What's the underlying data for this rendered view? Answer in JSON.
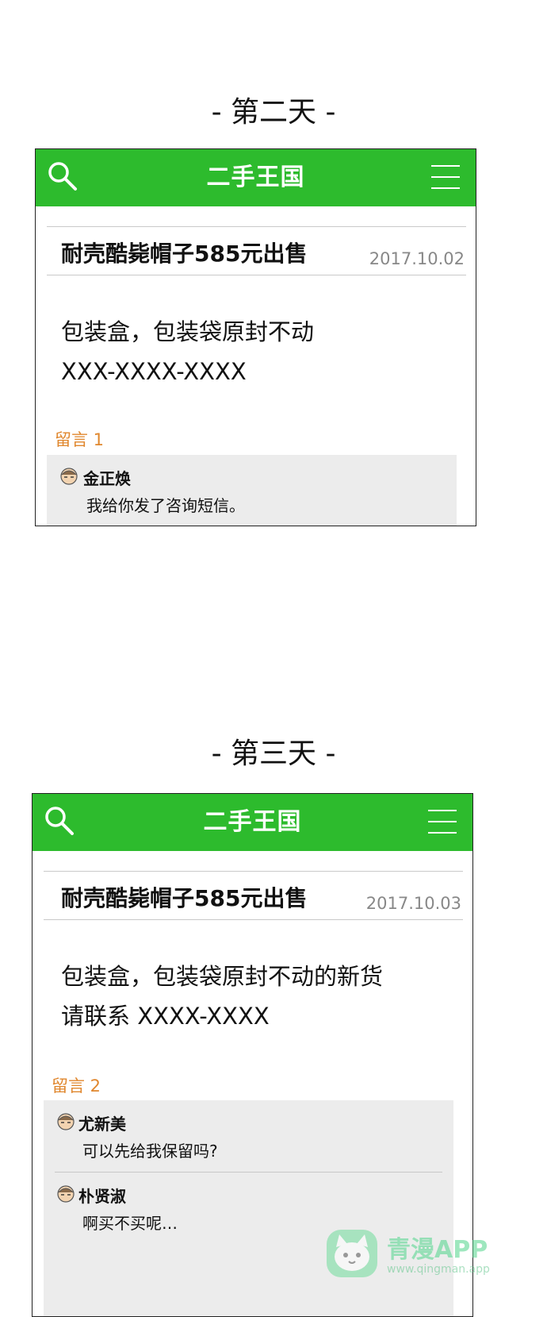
{
  "day2": {
    "title": "- 第二天 -",
    "app_title": "二手王国",
    "post_title": "耐壳酷毙帽子585元出售",
    "post_date": "2017.10.02",
    "body_lines": [
      "包装盒，包装袋原封不动",
      " XXX-XXXX-XXXX"
    ],
    "comments_label": "留言 1",
    "comments": [
      {
        "author": "金正焕",
        "text": "我给你发了咨询短信。"
      }
    ]
  },
  "day3": {
    "title": "-  第三天  -",
    "app_title": "二手王国",
    "post_title": "耐壳酷毙帽子585元出售",
    "post_date": "2017.10.03",
    "body_lines": [
      "包装盒，包装袋原封不动的新货",
      "请联系 XXXX-XXXX"
    ],
    "comments_label": "留言 2",
    "comments": [
      {
        "author": "尤新美",
        "text": "可以先给我保留吗?"
      },
      {
        "author": "朴贤淑",
        "text": "啊买不买呢…"
      }
    ]
  },
  "watermark": {
    "brand": "青漫APP",
    "url": "www.qingman.app"
  },
  "colors": {
    "topbar": "#2dbb2d",
    "comments_label": "#e0872e",
    "comments_bg": "#ececec",
    "date": "#888888"
  },
  "icons": {
    "search": "search-icon",
    "menu": "hamburger-menu-icon",
    "avatar": "avatar-icon"
  }
}
